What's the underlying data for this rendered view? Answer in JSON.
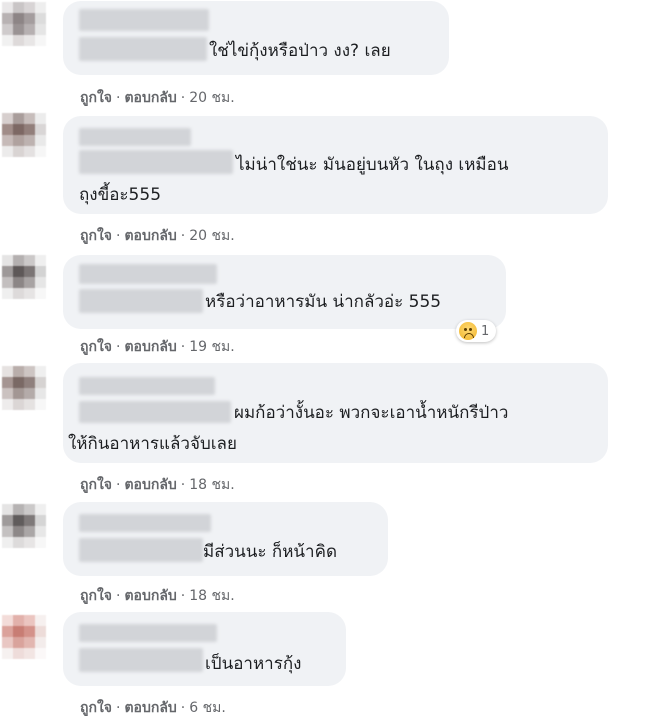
{
  "actions": {
    "like": "ถูกใจ",
    "reply": "ตอบกลับ",
    "dot": "·"
  },
  "comments": [
    {
      "text": "ใช่ไข่กุ้งหรือป่าว งง? เลย",
      "time": "20 ชม."
    },
    {
      "text_line1": "ไม่น่าใช่นะ มันอยู่บนหัว ในถุง เหมือน",
      "text_line2": "ถุงขี้อะ555",
      "time": "20 ชม."
    },
    {
      "text": "หรือว่าอาหารมัน น่ากลัวอ่ะ 555",
      "time": "19 ชม.",
      "reaction": {
        "icon": "sad-reaction-icon",
        "count": "1"
      }
    },
    {
      "text_line1": "ผมก้อว่างั้นอะ พวกจะเอาน้ำหนักรีป่าว",
      "text_line2": "ให้กินอาหารแล้วจับเลย",
      "time": "18 ชม."
    },
    {
      "text": "มีส่วนนะ ก็หน้าคิด",
      "time": "18 ชม."
    },
    {
      "text": "เป็นอาหารกุ้ง",
      "time": "6 ชม."
    }
  ]
}
